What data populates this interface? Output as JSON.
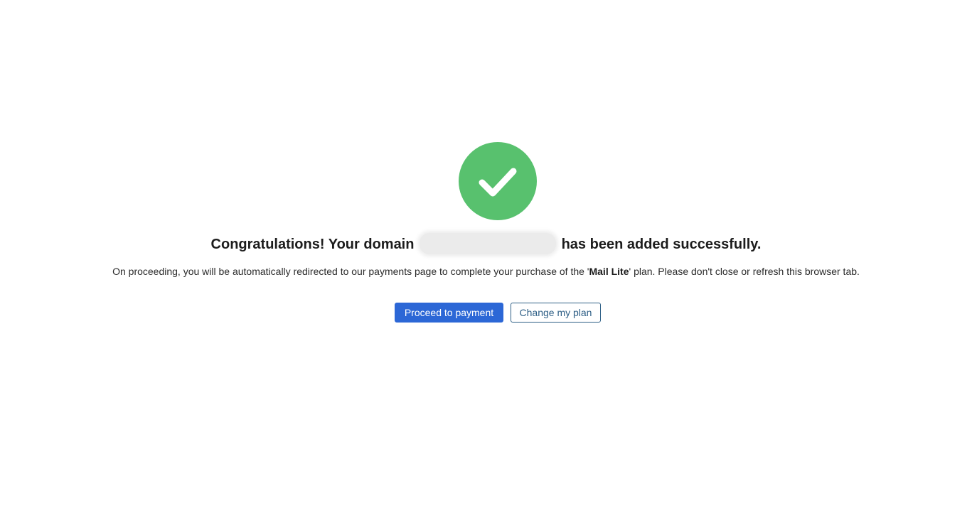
{
  "success": {
    "icon": "check-circle-icon",
    "color": "#58c16e"
  },
  "headline": {
    "prefix": "Congratulations! Your domain",
    "suffix": "has been added successfully."
  },
  "message": {
    "before_plan": "On proceeding, you will be automatically redirected to our payments page to complete your purchase of the '",
    "plan_name": "Mail Lite",
    "after_plan": "' plan. Please don't close or refresh this browser tab."
  },
  "actions": {
    "proceed_label": "Proceed to payment",
    "change_label": "Change my plan",
    "primary_color": "#2c67d6"
  }
}
